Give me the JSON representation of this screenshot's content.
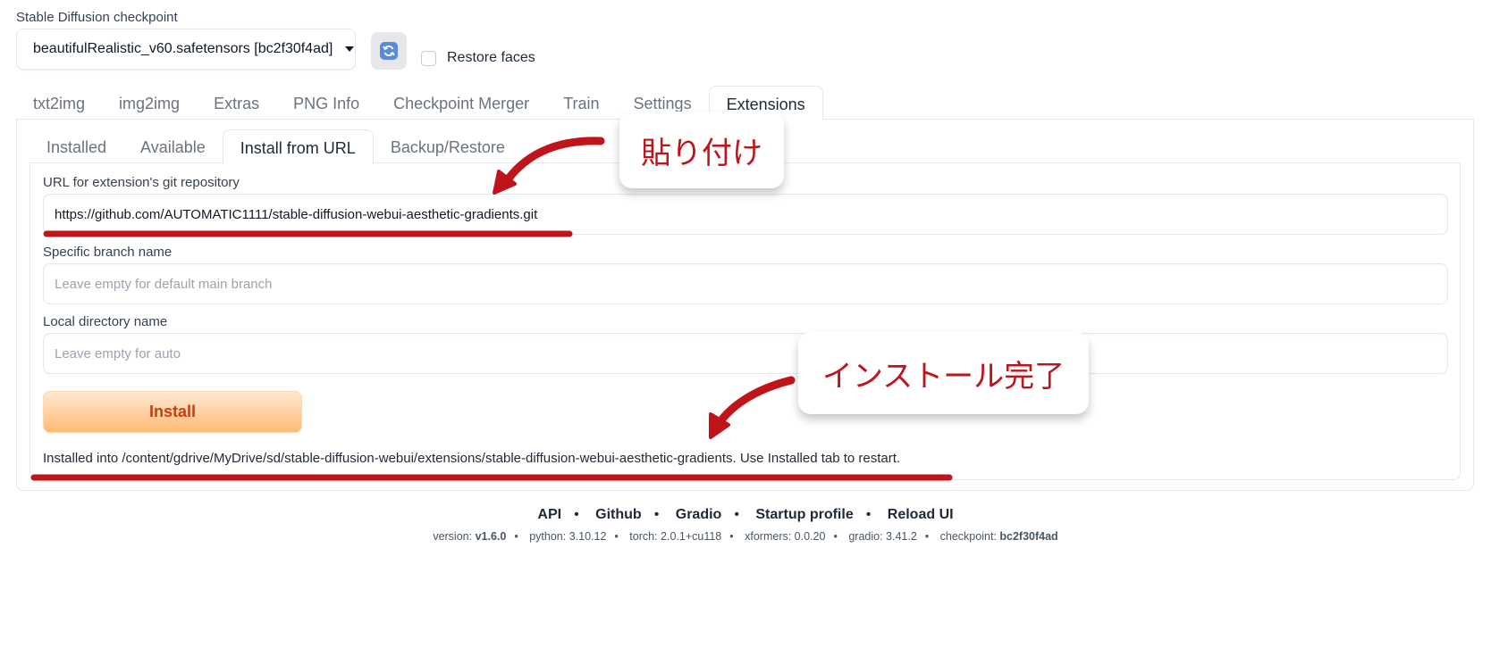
{
  "checkpoint": {
    "label": "Stable Diffusion checkpoint",
    "value": "beautifulRealistic_v60.safetensors [bc2f30f4ad]",
    "restore_faces_label": "Restore faces"
  },
  "main_tabs": [
    {
      "label": "txt2img"
    },
    {
      "label": "img2img"
    },
    {
      "label": "Extras"
    },
    {
      "label": "PNG Info"
    },
    {
      "label": "Checkpoint Merger"
    },
    {
      "label": "Train"
    },
    {
      "label": "Settings"
    },
    {
      "label": "Extensions",
      "active": true
    }
  ],
  "sub_tabs": [
    {
      "label": "Installed"
    },
    {
      "label": "Available"
    },
    {
      "label": "Install from URL",
      "active": true
    },
    {
      "label": "Backup/Restore"
    }
  ],
  "form": {
    "url_label": "URL for extension's git repository",
    "url_value": "https://github.com/AUTOMATIC1111/stable-diffusion-webui-aesthetic-gradients.git",
    "branch_label": "Specific branch name",
    "branch_placeholder": "Leave empty for default main branch",
    "dir_label": "Local directory name",
    "dir_placeholder": "Leave empty for auto",
    "install_label": "Install",
    "result_text": "Installed into /content/gdrive/MyDrive/sd/stable-diffusion-webui/extensions/stable-diffusion-webui-aesthetic-gradients. Use Installed tab to restart."
  },
  "footer": {
    "links": [
      "API",
      "Github",
      "Gradio",
      "Startup profile",
      "Reload UI"
    ],
    "versions": {
      "version_label": "version:",
      "version": "v1.6.0",
      "python": "python: 3.10.12",
      "torch": "torch: 2.0.1+cu118",
      "xformers": "xformers: 0.0.20",
      "gradio": "gradio: 3.41.2",
      "checkpoint_label": "checkpoint:",
      "checkpoint": "bc2f30f4ad"
    }
  },
  "annotations": {
    "paste": "貼り付け",
    "install_complete": "インストール完了"
  },
  "colors": {
    "annotation_red": "#c0141b",
    "install_text": "#c2410c"
  }
}
